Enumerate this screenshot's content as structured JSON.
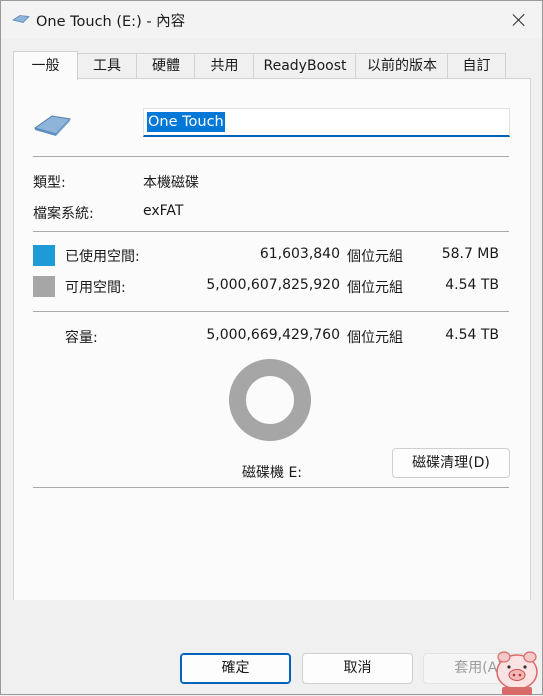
{
  "window": {
    "title": "One Touch (E:) - 內容"
  },
  "tabs": [
    {
      "label": "一般",
      "active": true
    },
    {
      "label": "工具"
    },
    {
      "label": "硬體"
    },
    {
      "label": "共用"
    },
    {
      "label": "ReadyBoost"
    },
    {
      "label": "以前的版本"
    },
    {
      "label": "自訂"
    }
  ],
  "drive": {
    "name": "One Touch",
    "type_label": "類型:",
    "type_value": "本機磁碟",
    "fs_label": "檔案系統:",
    "fs_value": "exFAT"
  },
  "usage": {
    "used": {
      "label": "已使用空間:",
      "bytes": "61,603,840",
      "unit": "個位元組",
      "size": "58.7 MB",
      "color": "#1e9ad6"
    },
    "free": {
      "label": "可用空間:",
      "bytes": "5,000,607,825,920",
      "unit": "個位元組",
      "size": "4.54 TB",
      "color": "#a6a6a6"
    },
    "capacity": {
      "label": "容量:",
      "bytes": "5,000,669,429,760",
      "unit": "個位元組",
      "size": "4.54 TB"
    },
    "used_fraction": 1.23e-05
  },
  "drive_label": "磁碟機 E:",
  "buttons": {
    "cleanup": "磁碟清理(D)",
    "ok": "確定",
    "cancel": "取消",
    "apply": "套用(A)"
  }
}
